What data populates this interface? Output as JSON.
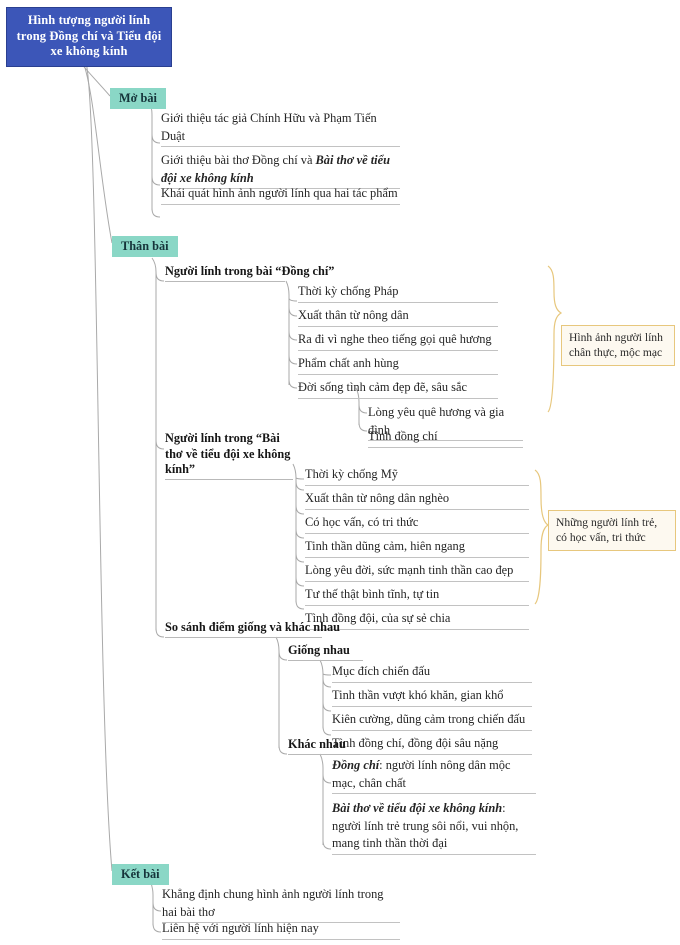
{
  "mindmap": {
    "root": {
      "label": "Hình tượng người lính trong Đồng chí và Tiểu đội xe không kính",
      "color": "#3c56b8",
      "text_color": "#ffffff"
    },
    "branch_color": "#8ad7c6",
    "callout_bg": "#fdf9f0",
    "callout_border": "#e7c77d",
    "line_color": "#a9a9a9",
    "branches": [
      {
        "label": "Mở bài",
        "leaves": [
          {
            "text": "Giới thiệu tác giả Chính Hữu và Phạm Tiến Duật"
          },
          {
            "text": "Giới thiệu bài thơ Đồng chí và ",
            "emphasis": "Bài thơ về tiểu đội xe không kính"
          },
          {
            "text": "Khái quát hình ảnh người lính qua hai tác phẩm"
          }
        ]
      },
      {
        "label": "Thân bài",
        "sections": [
          {
            "heading": "Người lính trong bài “Đồng chí”",
            "leaves": [
              {
                "text": "Thời kỳ chống Pháp"
              },
              {
                "text": "Xuất thân từ nông dân"
              },
              {
                "text": "Ra đi vì nghe theo tiếng gọi quê hương"
              },
              {
                "text": "Phẩm chất anh hùng"
              },
              {
                "text": "Đời sống tình cảm đẹp đẽ, sâu sắc"
              }
            ],
            "subleaves": [
              {
                "text": "Lòng yêu quê hương và gia đình"
              },
              {
                "text": "Tình đồng chí"
              }
            ],
            "callout": "Hình ảnh người lính chân thực, mộc mạc"
          },
          {
            "heading": "Người lính trong “Bài thơ về tiểu đội xe không kính”",
            "leaves": [
              {
                "text": "Thời kỳ chống Mỹ"
              },
              {
                "text": "Xuất thân từ nông dân nghèo"
              },
              {
                "text": "Có học vấn, có tri thức"
              },
              {
                "text": "Tinh thần dũng cảm, hiên ngang"
              },
              {
                "text": "Lòng yêu đời, sức mạnh tinh thần cao đẹp"
              },
              {
                "text": "Tư thế thật bình tĩnh, tự tin"
              },
              {
                "text": "Tình đồng đội, của sự sẻ chia"
              }
            ],
            "callout": "Những người lính trẻ, có học vấn, tri thức"
          },
          {
            "heading": "So sánh điểm giống và khác nhau",
            "subsections": [
              {
                "heading": "Giống nhau",
                "leaves": [
                  {
                    "text": "Mục đích chiến đấu"
                  },
                  {
                    "text": "Tinh thần vượt khó khăn, gian khổ"
                  },
                  {
                    "text": "Kiên cường, dũng cảm trong chiến đấu"
                  },
                  {
                    "text": "Tình đồng chí, đồng đội sâu nặng"
                  }
                ]
              },
              {
                "heading": "Khác nhau",
                "leaves": [
                  {
                    "emphasis": "Đồng chí",
                    "text": ": người lính nông dân mộc mạc, chân chất"
                  },
                  {
                    "emphasis": "Bài thơ về tiểu đội xe không kính",
                    "text": ": người lính trẻ trung sôi nổi, vui nhộn, mang tinh thần thời đại"
                  }
                ]
              }
            ]
          }
        ]
      },
      {
        "label": "Kết bài",
        "leaves": [
          {
            "text": "Khẳng định chung hình ảnh người lính trong hai bài thơ"
          },
          {
            "text": "Liên hệ với người lính hiện nay"
          }
        ]
      }
    ]
  }
}
